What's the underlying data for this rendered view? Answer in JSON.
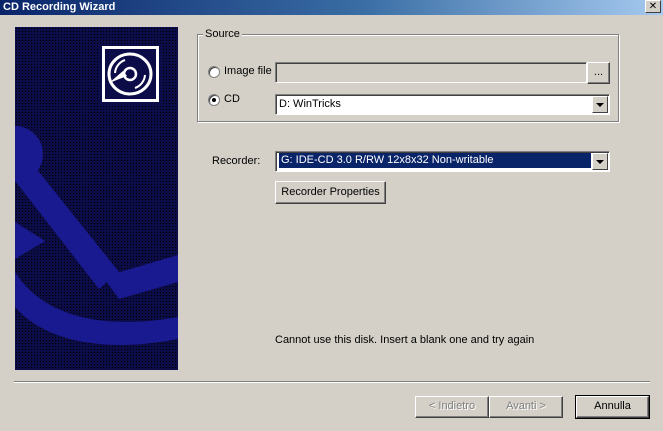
{
  "window": {
    "title": "CD Recording Wizard",
    "close_glyph": "✕"
  },
  "source": {
    "group_label": "Source",
    "image_file_label": "Image file",
    "image_file_value": "",
    "browse_label": "...",
    "cd_label": "CD",
    "cd_value": "D: WinTricks",
    "selected": "cd"
  },
  "recorder": {
    "label": "Recorder:",
    "value": "G: IDE-CD  3.0 R/RW 12x8x32 Non-writable",
    "properties_label": "Recorder Properties"
  },
  "status_message": "Cannot use this disk. Insert a blank one and try again",
  "footer": {
    "back_label": "< Indietro",
    "next_label": "Avanti >",
    "cancel_label": "Annulla"
  },
  "icons": {
    "art_cd": "cd-disc-icon",
    "anchor": "anchor-graphic-icon"
  },
  "colors": {
    "title_bar": "#0a246a",
    "art_background": "#0c0c48",
    "anchor_blue": "#1a1a90",
    "selection": "#0a246a",
    "dialog": "#d4d0c8"
  }
}
